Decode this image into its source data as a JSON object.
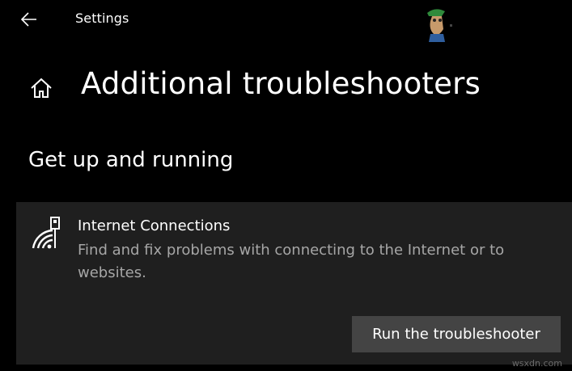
{
  "window": {
    "app_title": "Settings",
    "back_icon": "arrow-left-icon"
  },
  "header": {
    "home_icon": "home-icon",
    "page_title": "Additional troubleshooters"
  },
  "section": {
    "title": "Get up and running"
  },
  "troubleshooter": {
    "icon": "wifi-network-icon",
    "title": "Internet Connections",
    "description": "Find and fix problems with connecting to the Internet or to websites.",
    "run_button_label": "Run the troubleshooter"
  },
  "watermark": "wsxdn.com",
  "colors": {
    "background": "#000000",
    "card": "#1f1f1f",
    "button": "#444444",
    "description_text": "#a6a6a6"
  }
}
